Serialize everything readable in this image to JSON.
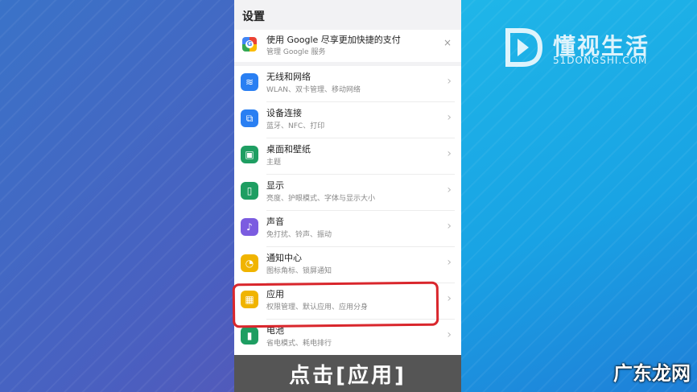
{
  "settings": {
    "title": "设置",
    "google": {
      "title": "使用 Google 尽享更加快捷的支付",
      "subtitle": "管理 Google 服务",
      "close": "×"
    },
    "items": [
      {
        "label": "无线和网络",
        "sub": "WLAN、双卡管理、移动网络",
        "icon": "wifi-icon",
        "color": "#2a7ff2",
        "glyph": "≋"
      },
      {
        "label": "设备连接",
        "sub": "蓝牙、NFC、打印",
        "icon": "device-connect-icon",
        "color": "#2a7ff2",
        "glyph": "⧉"
      },
      {
        "label": "桌面和壁纸",
        "sub": "主题",
        "icon": "wallpaper-icon",
        "color": "#1e9e62",
        "glyph": "▣"
      },
      {
        "label": "显示",
        "sub": "亮度、护眼模式、字体与显示大小",
        "icon": "display-icon",
        "color": "#1e9e62",
        "glyph": "▯"
      },
      {
        "label": "声音",
        "sub": "免打扰、铃声、振动",
        "icon": "sound-icon",
        "color": "#7b5ce0",
        "glyph": "♪"
      },
      {
        "label": "通知中心",
        "sub": "图标角标、锁屏通知",
        "icon": "notification-icon",
        "color": "#f0b400",
        "glyph": "◔"
      },
      {
        "label": "应用",
        "sub": "权限管理、默认应用、应用分身",
        "icon": "apps-icon",
        "color": "#f0b400",
        "glyph": "▦"
      },
      {
        "label": "电池",
        "sub": "省电模式、耗电排行",
        "icon": "battery-icon",
        "color": "#1e9e62",
        "glyph": "▮"
      }
    ]
  },
  "caption": "点击[应用]",
  "logo": {
    "text": "懂视生活",
    "sub": "51DONGSHI.COM"
  },
  "watermark": "广东龙网",
  "chevron": "›"
}
